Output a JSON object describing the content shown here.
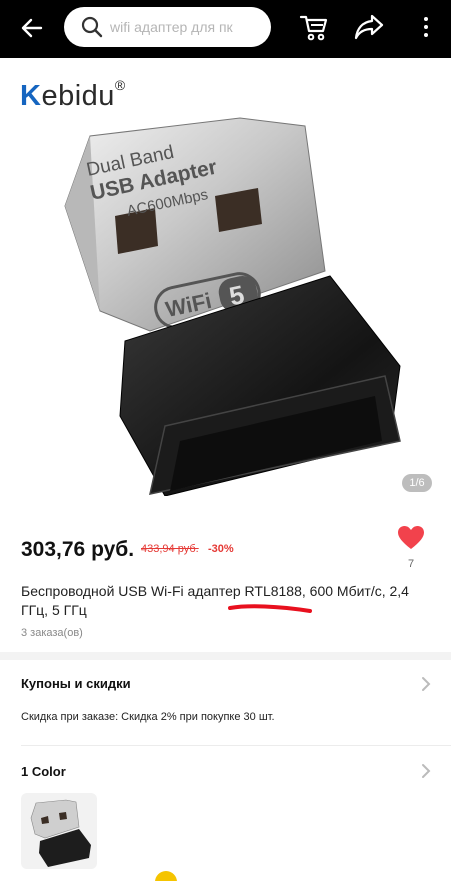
{
  "header": {
    "search_placeholder": "wifi адаптер для пк",
    "icons": [
      "back-arrow-icon",
      "search-icon",
      "cart-icon",
      "share-icon",
      "more-icon"
    ],
    "background": "#000000"
  },
  "gallery": {
    "brand_first": "K",
    "brand_rest": "ebidu",
    "brand_mark": "®",
    "counter": "1/6",
    "image_text": {
      "line1": "Dual Band",
      "line2": "USB Adapter",
      "line3": "AC600Mbps",
      "badge": "WiFi",
      "badge_num": "5"
    }
  },
  "product": {
    "price": "303,76 руб.",
    "old_price": "433,94 руб.",
    "discount": "-30%",
    "wishlist_count": "7",
    "title": "Беспроводной USB Wi-Fi адаптер RTL8188, 600 Мбит/с, 2,4 ГГц, 5 ГГц",
    "orders": "3 заказа(ов)"
  },
  "coupons": {
    "title": "Купоны и скидки",
    "description": "Скидка при заказе: Скидка 2% при покупке 30 шт."
  },
  "color": {
    "title": "1 Color"
  },
  "colors": {
    "accent": "#e53935",
    "brand_blue": "#1565c0",
    "heart": "#f2424c"
  }
}
